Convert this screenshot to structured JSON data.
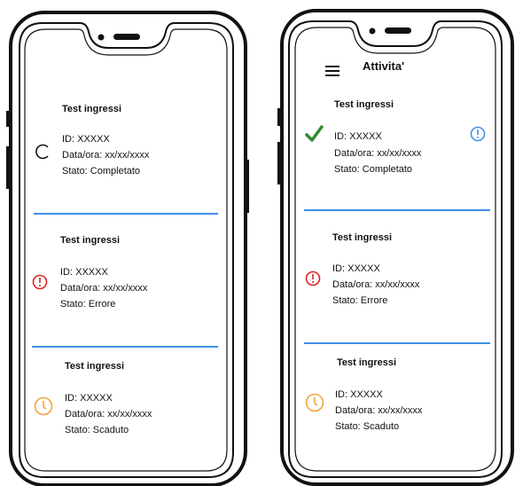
{
  "phones": [
    {
      "header_title": "",
      "cards": [
        {
          "title": "Test ingressi",
          "id": "ID: XXXXX",
          "datetime": "Data/ora: xx/xx/xxxx",
          "status": "Stato: Completato",
          "icon": "loading-spinner-icon"
        },
        {
          "title": "Test ingressi",
          "id": "ID: XXXXX",
          "datetime": "Data/ora: xx/xx/xxxx",
          "status": "Stato: Errore",
          "icon": "error-icon"
        },
        {
          "title": "Test ingressi",
          "id": "ID: XXXXX",
          "datetime": "Data/ora: xx/xx/xxxx",
          "status": "Stato: Scaduto",
          "icon": "clock-icon"
        }
      ]
    },
    {
      "header_title": "Attivita'",
      "cards": [
        {
          "title": "Test ingressi",
          "id": "ID: XXXXX",
          "datetime": "Data/ora: xx/xx/xxxx",
          "status": "Stato: Completato",
          "icon": "checkmark-icon",
          "info_icon": "info-icon"
        },
        {
          "title": "Test ingressi",
          "id": "ID: XXXXX",
          "datetime": "Data/ora: xx/xx/xxxx",
          "status": "Stato: Errore",
          "icon": "error-icon"
        },
        {
          "title": "Test ingressi",
          "id": "ID: XXXXX",
          "datetime": "Data/ora: xx/xx/xxxx",
          "status": "Stato: Scaduto",
          "icon": "clock-icon"
        }
      ]
    }
  ],
  "colors": {
    "divider": "#3f8fe6",
    "error": "#e02020",
    "expired": "#f5a13a",
    "success": "#2e8b2e",
    "info": "#3f8fe6"
  }
}
